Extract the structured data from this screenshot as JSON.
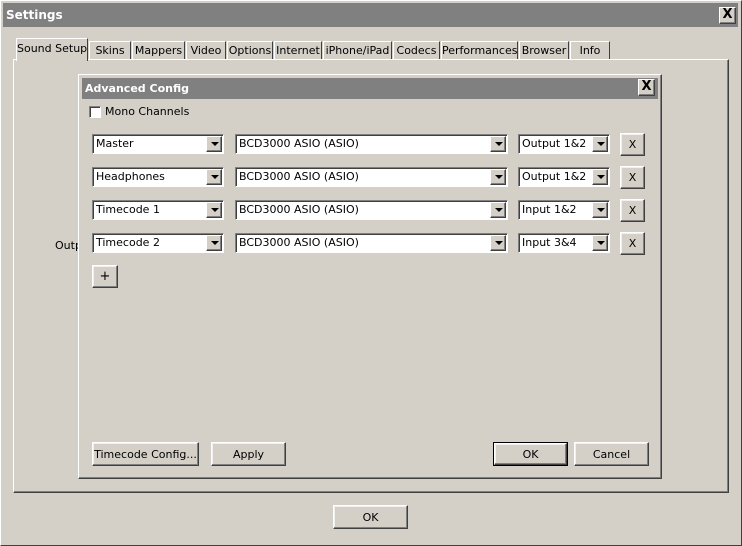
{
  "window": {
    "title": "Settings",
    "close_label": "X"
  },
  "tabs": [
    {
      "label": "Sound Setup",
      "active": true
    },
    {
      "label": "Skins"
    },
    {
      "label": "Mappers"
    },
    {
      "label": "Video"
    },
    {
      "label": "Options"
    },
    {
      "label": "Internet"
    },
    {
      "label": "iPhone/iPad"
    },
    {
      "label": "Codecs"
    },
    {
      "label": "Performances"
    },
    {
      "label": "Browser"
    },
    {
      "label": "Info"
    }
  ],
  "background_label": "Outp",
  "footer": {
    "ok_label": "OK"
  },
  "dialog": {
    "title": "Advanced Config",
    "close_label": "X",
    "mono_channels_label": "Mono Channels",
    "rows": [
      {
        "channel": "Master",
        "device": "BCD3000 ASIO (ASIO)",
        "port": "Output 1&2",
        "remove_label": "X"
      },
      {
        "channel": "Headphones",
        "device": "BCD3000 ASIO (ASIO)",
        "port": "Output 1&2",
        "remove_label": "X"
      },
      {
        "channel": "Timecode 1",
        "device": "BCD3000 ASIO (ASIO)",
        "port": "Input 1&2",
        "remove_label": "X"
      },
      {
        "channel": "Timecode 2",
        "device": "BCD3000 ASIO (ASIO)",
        "port": "Input 3&4",
        "remove_label": "X"
      }
    ],
    "add_label": "+",
    "timecode_config_label": "Timecode Config...",
    "apply_label": "Apply",
    "ok_label": "OK",
    "cancel_label": "Cancel"
  }
}
